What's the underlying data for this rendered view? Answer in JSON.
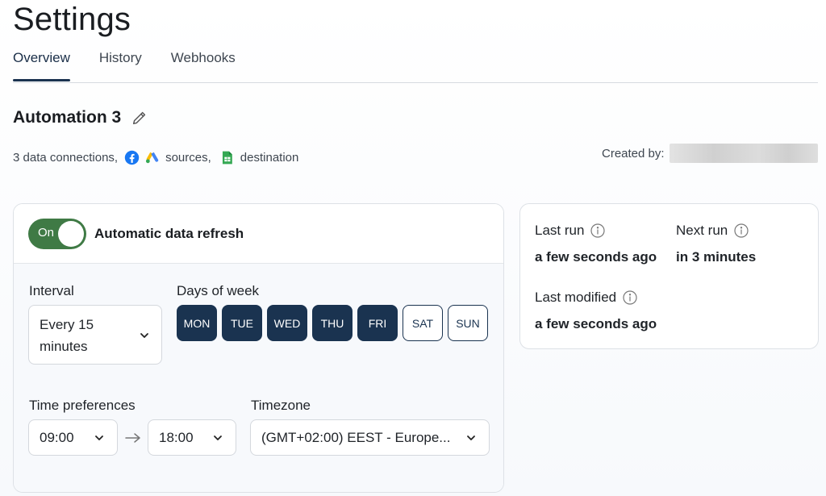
{
  "page": {
    "title": "Settings"
  },
  "tabs": [
    {
      "label": "Overview",
      "active": true
    },
    {
      "label": "History",
      "active": false
    },
    {
      "label": "Webhooks",
      "active": false
    }
  ],
  "automation": {
    "name": "Automation 3",
    "connections_text": "3 data connections,",
    "sources_text": "sources,",
    "destination_text": "destination",
    "created_by_label": "Created by:",
    "source_icons": [
      "facebook-icon",
      "google-ads-icon"
    ],
    "destination_icon": "google-sheets-icon"
  },
  "refresh": {
    "toggle_label": "On",
    "toggle_on": true,
    "title": "Automatic data refresh",
    "interval_label": "Interval",
    "interval_line1": "Every 15",
    "interval_line2": "minutes",
    "days_label": "Days of week",
    "days": [
      {
        "label": "MON",
        "selected": true
      },
      {
        "label": "TUE",
        "selected": true
      },
      {
        "label": "WED",
        "selected": true
      },
      {
        "label": "THU",
        "selected": true
      },
      {
        "label": "FRI",
        "selected": true
      },
      {
        "label": "SAT",
        "selected": false
      },
      {
        "label": "SUN",
        "selected": false
      }
    ],
    "time_label": "Time preferences",
    "time_start": "09:00",
    "time_end": "18:00",
    "timezone_label": "Timezone",
    "timezone_value": "(GMT+02:00) EEST - Europe..."
  },
  "status": {
    "last_run_label": "Last run",
    "last_run_value": "a few seconds ago",
    "next_run_label": "Next run",
    "next_run_value": "in 3 minutes",
    "last_modified_label": "Last modified",
    "last_modified_value": "a few seconds ago"
  },
  "colors": {
    "accent": "#1a3350",
    "toggle_on": "#3f7a45",
    "facebook": "#1877f2",
    "sheets": "#34a853"
  }
}
